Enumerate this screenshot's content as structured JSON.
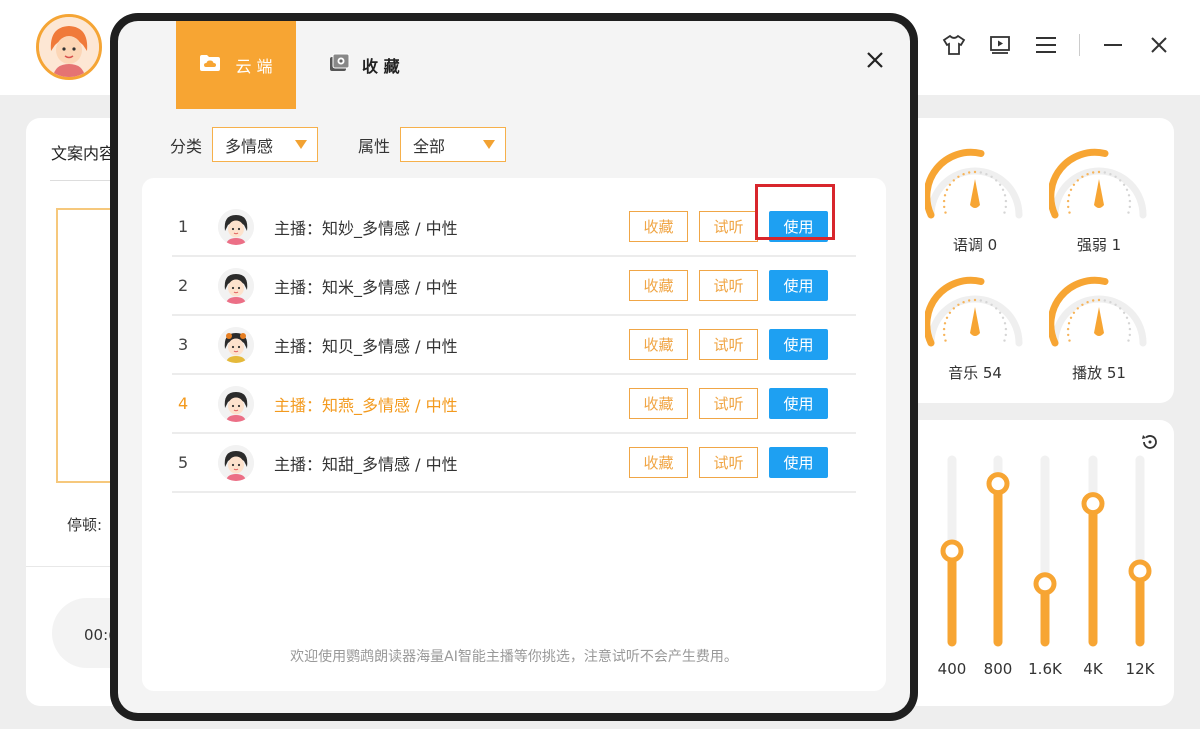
{
  "app": {
    "left_panel": {
      "title": "文案内容",
      "pause_label": "停顿:",
      "time": "00:("
    },
    "dials": [
      {
        "label": "语调 0",
        "value": 0
      },
      {
        "label": "强弱 1",
        "value": 1
      },
      {
        "label": "音乐 54",
        "value": 54
      },
      {
        "label": "播放 51",
        "value": 51
      }
    ],
    "equalizer": {
      "bands": [
        {
          "label": "400",
          "level": 0.5
        },
        {
          "label": "800",
          "level": 0.87
        },
        {
          "label": "1.6K",
          "level": 0.32
        },
        {
          "label": "4K",
          "level": 0.76
        },
        {
          "label": "12K",
          "level": 0.39
        }
      ]
    },
    "window_icons": [
      "skin-icon",
      "video-icon",
      "menu-icon",
      "minimize-icon",
      "close-icon"
    ]
  },
  "modal": {
    "tabs": [
      {
        "label": "云 端",
        "active": true,
        "icon": "cloud-folder-icon"
      },
      {
        "label": "收 藏",
        "active": false,
        "icon": "favorites-icon"
      }
    ],
    "filters": {
      "category_label": "分类",
      "category_value": "多情感",
      "attribute_label": "属性",
      "attribute_value": "全部"
    },
    "rows": [
      {
        "num": "1",
        "text": "主播：知妙_多情感 / 中性",
        "fav": "收藏",
        "listen": "试听",
        "use": "使用",
        "highlight": false,
        "boxed": true
      },
      {
        "num": "2",
        "text": "主播：知米_多情感 / 中性",
        "fav": "收藏",
        "listen": "试听",
        "use": "使用",
        "highlight": false,
        "boxed": false
      },
      {
        "num": "3",
        "text": "主播：知贝_多情感 / 中性",
        "fav": "收藏",
        "listen": "试听",
        "use": "使用",
        "highlight": false,
        "boxed": false
      },
      {
        "num": "4",
        "text": "主播：知燕_多情感 / 中性",
        "fav": "收藏",
        "listen": "试听",
        "use": "使用",
        "highlight": true,
        "boxed": false
      },
      {
        "num": "5",
        "text": "主播：知甜_多情感 / 中性",
        "fav": "收藏",
        "listen": "试听",
        "use": "使用",
        "highlight": false,
        "boxed": false
      }
    ],
    "footer_note": "欢迎使用鹦鹉朗读器海量AI智能主播等你挑选，注意试听不会产生费用。"
  },
  "colors": {
    "accent": "#f7a533",
    "primary_button": "#1ea0f2",
    "highlight_text": "#f39a1e",
    "annotation": "#d8262c"
  }
}
